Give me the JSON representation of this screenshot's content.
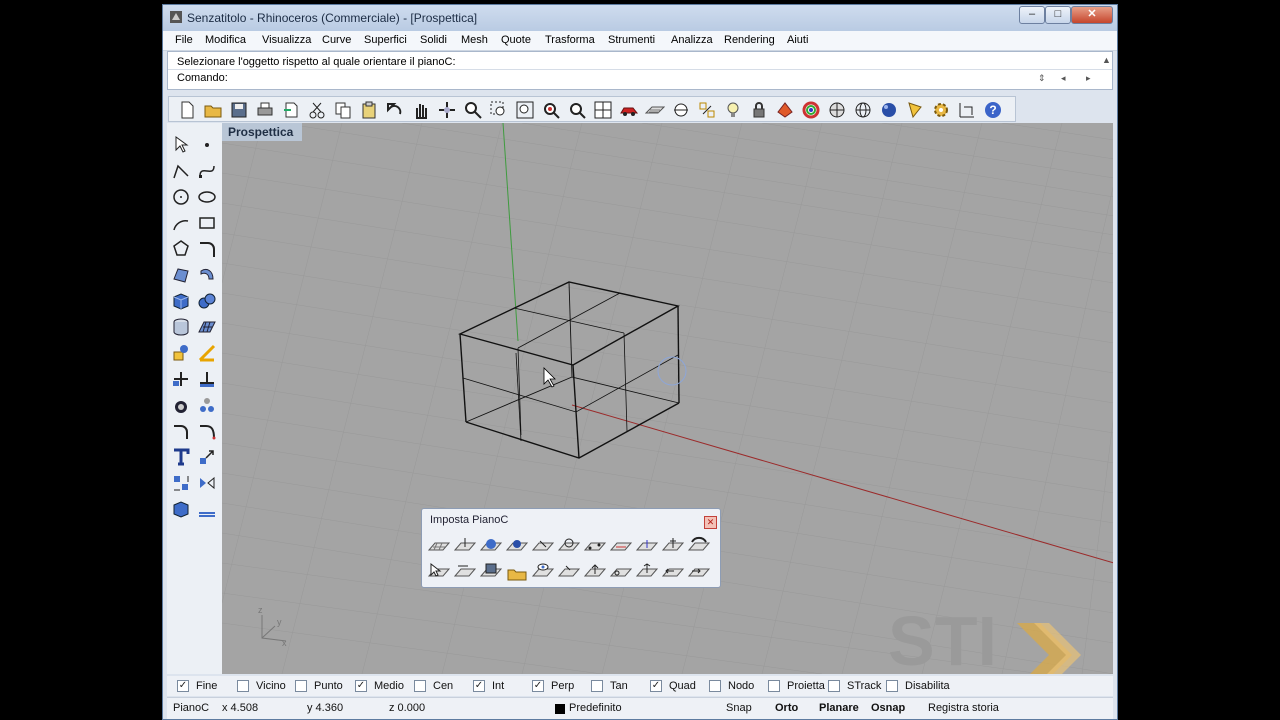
{
  "window": {
    "title": "Senzatitolo - Rhinoceros (Commerciale) - [Prospettica]",
    "controls": {
      "minimize": "–",
      "maximize": "□",
      "close": "✕"
    }
  },
  "menu": [
    "File",
    "Modifica",
    "Visualizza",
    "Curve",
    "Superfici",
    "Solidi",
    "Mesh",
    "Quote",
    "Trasforma",
    "Strumenti",
    "Analizza",
    "Rendering",
    "Aiuti"
  ],
  "command": {
    "history": "Selezionare l'oggetto rispetto al quale orientare il pianoC:",
    "prompt": "Comando:"
  },
  "viewport": {
    "tab_label": "Prospettica",
    "axis_labels": {
      "z": "z",
      "y": "y",
      "x": "x"
    },
    "watermark": "STI"
  },
  "palette": {
    "title": "Imposta PianoC"
  },
  "osnaps": [
    {
      "label": "Fine",
      "checked": true
    },
    {
      "label": "Vicino",
      "checked": false
    },
    {
      "label": "Punto",
      "checked": false
    },
    {
      "label": "Medio",
      "checked": true
    },
    {
      "label": "Cen",
      "checked": false
    },
    {
      "label": "Int",
      "checked": true
    },
    {
      "label": "Perp",
      "checked": true
    },
    {
      "label": "Tan",
      "checked": false
    },
    {
      "label": "Quad",
      "checked": true
    },
    {
      "label": "Nodo",
      "checked": false
    },
    {
      "label": "Proietta",
      "checked": false
    },
    {
      "label": "STrack",
      "checked": false
    },
    {
      "label": "Disabilita",
      "checked": false
    }
  ],
  "status": {
    "cplane": "PianoC",
    "x": "x 4.508",
    "y": "y 4.360",
    "z": "z 0.000",
    "layer": "Predefinito",
    "snap": "Snap",
    "orto": "Orto",
    "planare": "Planare",
    "osnap": "Osnap",
    "history": "Registra storia"
  },
  "colors": {
    "viewport_bg": "#a4a4a4",
    "grid": "#999999",
    "x_axis": "#9b2b2b",
    "y_axis": "#3f9b3f"
  }
}
